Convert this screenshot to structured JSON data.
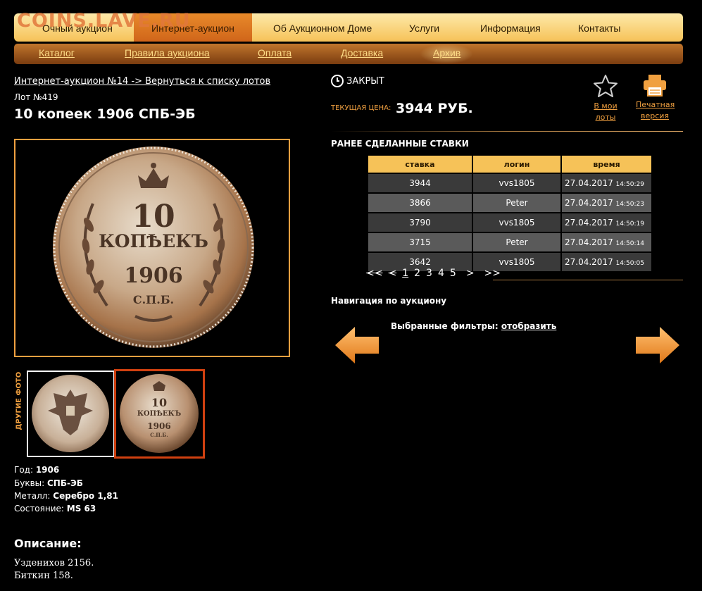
{
  "watermark": "COINS.LAVE.RU",
  "topnav": {
    "items": [
      "Очный аукцион",
      "Интернет-аукцион",
      "Об Аукционном Доме",
      "Услуги",
      "Информация",
      "Контакты"
    ]
  },
  "subnav": {
    "items": [
      "Каталог",
      "Правила аукциона",
      "Оплата",
      "Доставка",
      "Архив"
    ]
  },
  "breadcrumb": "Интернет-аукцион №14 -> Вернуться к списку лотов",
  "lot_number": "Лот №419",
  "lot_title": "10 копеек 1906 СПБ-ЭБ",
  "coin_face": {
    "value": "10",
    "word": "КОПѢЕКЪ",
    "year": "1906",
    "mint": "С.П.Б."
  },
  "other_photos_label": "ДРУГИЕ ФОТО",
  "specs": [
    {
      "label": "Год: ",
      "value": "1906"
    },
    {
      "label": "Буквы: ",
      "value": "СПБ-ЭБ"
    },
    {
      "label": "Металл: ",
      "value": "Серебро 1,81"
    },
    {
      "label": "Состояние: ",
      "value": "MS 63"
    }
  ],
  "description": {
    "heading": "Описание:",
    "lines": [
      "Узденихов 2156.",
      "Биткин 158."
    ]
  },
  "status": "ЗАКРЫТ",
  "price": {
    "label": "ТЕКУЩАЯ ЦЕНА:",
    "value": "3944 РУБ."
  },
  "favorites_label": "В мои лоты",
  "print_label_1": "Печатная",
  "print_label_2": "версия",
  "bids": {
    "heading": "РАНЕЕ СДЕЛАННЫЕ СТАВКИ",
    "columns": [
      "ставка",
      "логин",
      "время"
    ],
    "rows": [
      {
        "bid": "3944",
        "login": "vvs1805",
        "date": "27.04.2017",
        "time": "14:50:29"
      },
      {
        "bid": "3866",
        "login": "Peter",
        "date": "27.04.2017",
        "time": "14:50:23"
      },
      {
        "bid": "3790",
        "login": "vvs1805",
        "date": "27.04.2017",
        "time": "14:50:19"
      },
      {
        "bid": "3715",
        "login": "Peter",
        "date": "27.04.2017",
        "time": "14:50:14"
      },
      {
        "bid": "3642",
        "login": "vvs1805",
        "date": "27.04.2017",
        "time": "14:50:05"
      }
    ]
  },
  "pager": {
    "first": "<<",
    "prev": "<",
    "pages": [
      "1",
      "2",
      "3",
      "4",
      "5"
    ],
    "next": ">",
    "last": ">>"
  },
  "navigation_title": "Навигация по аукциону",
  "filters": {
    "label": "Выбранные фильтры: ",
    "link": "отобразить"
  },
  "colors": {
    "accent": "#f0a040",
    "nav_gold": "#f6c258",
    "active_tab": "#d0651a",
    "background": "#000000"
  }
}
